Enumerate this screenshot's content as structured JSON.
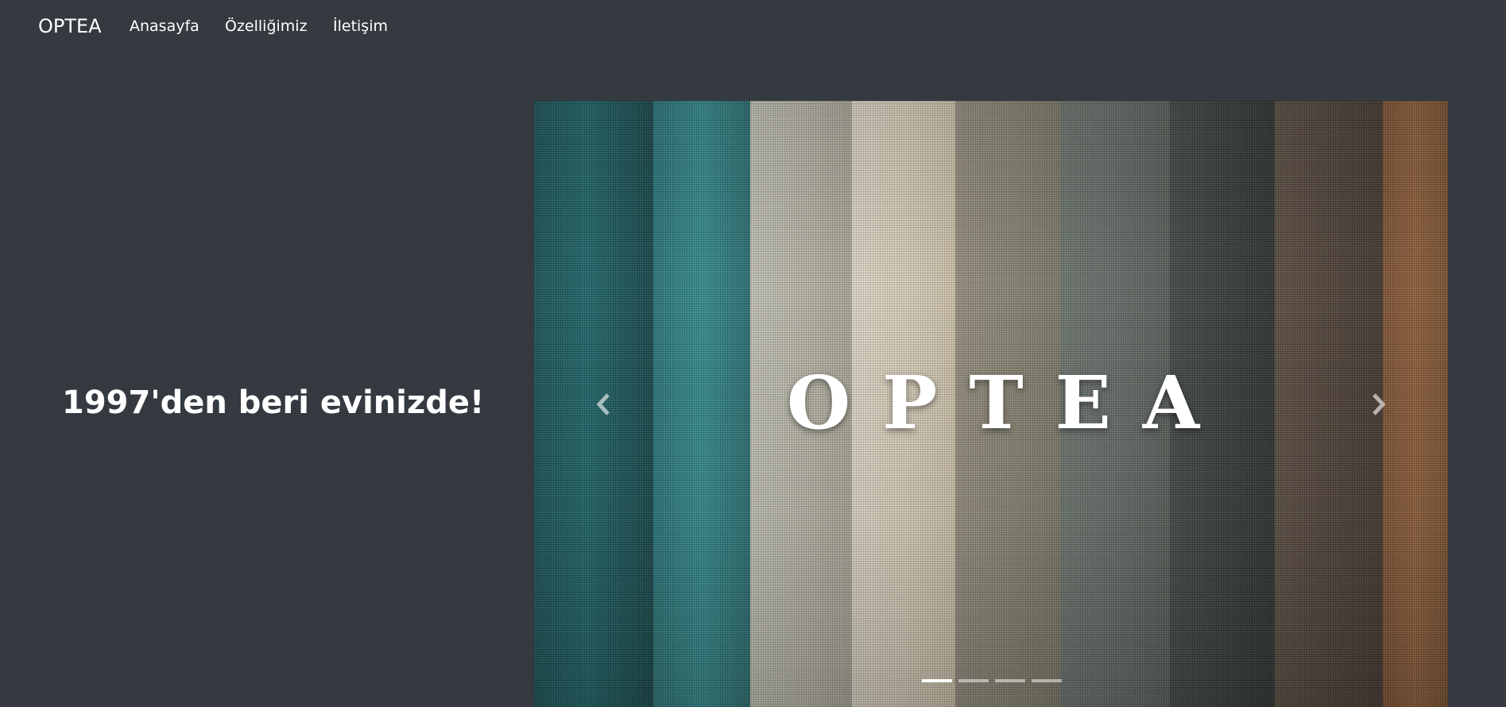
{
  "navbar": {
    "brand": "OPTEA",
    "links": [
      {
        "label": "Anasayfa"
      },
      {
        "label": "Özelliğimiz"
      },
      {
        "label": "İletişim"
      }
    ]
  },
  "hero": {
    "heading": "1997'den beri evinizde!"
  },
  "carousel": {
    "logo_text": "OPTEA",
    "prev_icon": "chevron-left-icon",
    "next_icon": "chevron-right-icon",
    "slide_count": 4,
    "active_index": 0,
    "fabric_colors": [
      "#1e5f63",
      "#2f7f82",
      "#b8b5a6",
      "#d8cfbd",
      "#8a8474",
      "#5f6762",
      "#353c3a",
      "#54463b",
      "#8a5a35"
    ]
  },
  "colors": {
    "background": "#343a40",
    "text": "#ffffff"
  }
}
